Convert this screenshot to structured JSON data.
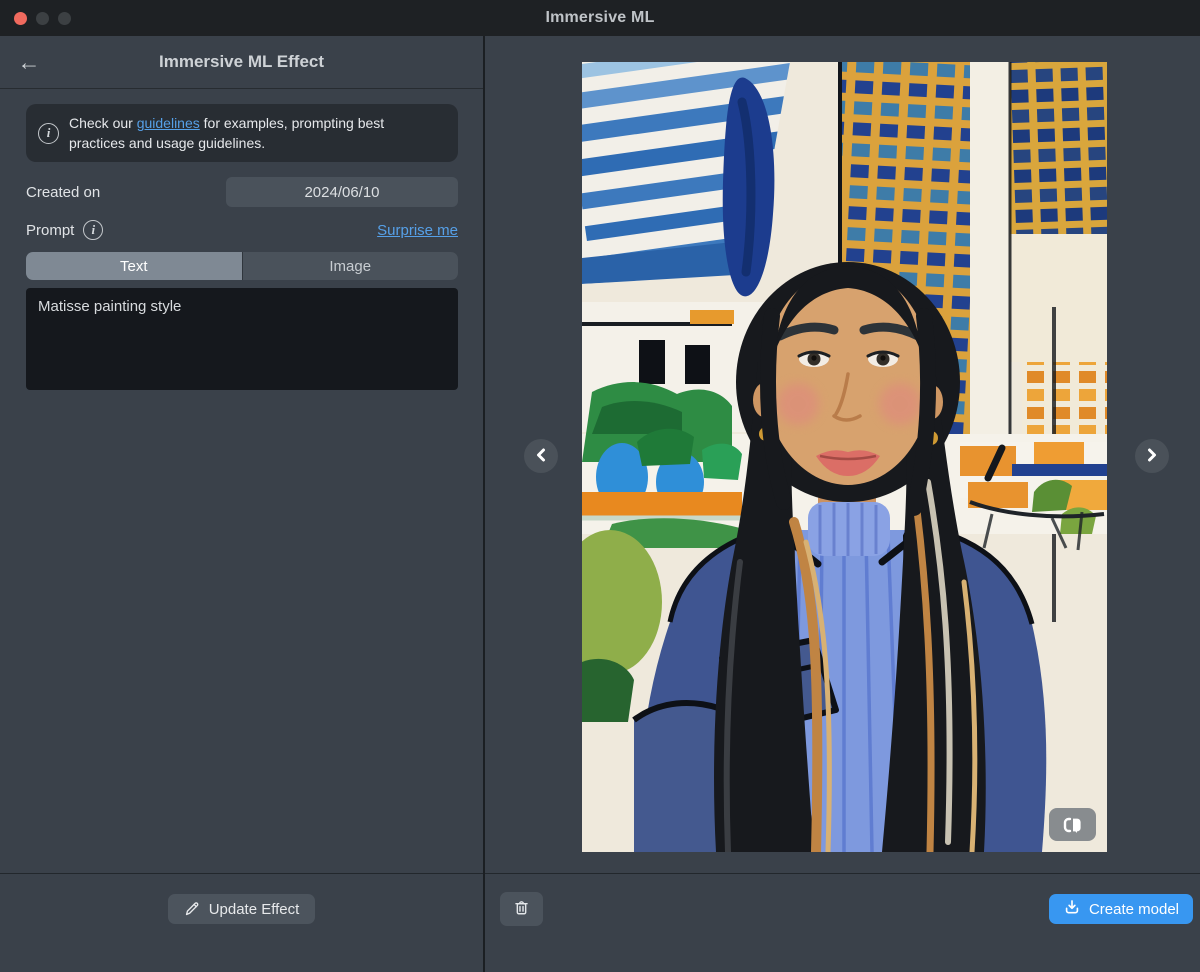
{
  "titlebar": {
    "title": "Immersive ML"
  },
  "left_panel": {
    "header": {
      "title": "Immersive ML Effect",
      "back_icon": "arrow-left"
    },
    "info_box": {
      "prefix": "Check our ",
      "link_text": "guidelines",
      "suffix": " for examples, prompting best practices and usage guidelines."
    },
    "created_on": {
      "label": "Created on",
      "value": "2024/06/10"
    },
    "prompt": {
      "label": "Prompt",
      "surprise_label": "Surprise me"
    },
    "tabs": [
      {
        "label": "Text",
        "selected": true
      },
      {
        "label": "Image",
        "selected": false
      }
    ],
    "prompt_input": {
      "value": "Matisse painting style"
    },
    "update_button": {
      "label": "Update Effect",
      "icon": "pencil-icon"
    }
  },
  "right_panel": {
    "preview_alt": "Matisse-style painted portrait of a woman with long dark hair in a blue turtleneck and denim jacket in front of city buildings",
    "delete_button": {
      "icon": "trash-icon"
    },
    "create_button": {
      "label": "Create model",
      "icon": "download-icon"
    },
    "compare_button": {
      "icon": "compare-icon"
    },
    "nav": {
      "prev_icon": "chevron-left-icon",
      "next_icon": "chevron-right-icon"
    }
  },
  "colors": {
    "accent_blue": "#3897f1",
    "link_blue": "#56a0e8",
    "traffic_red": "#f06a5e"
  }
}
